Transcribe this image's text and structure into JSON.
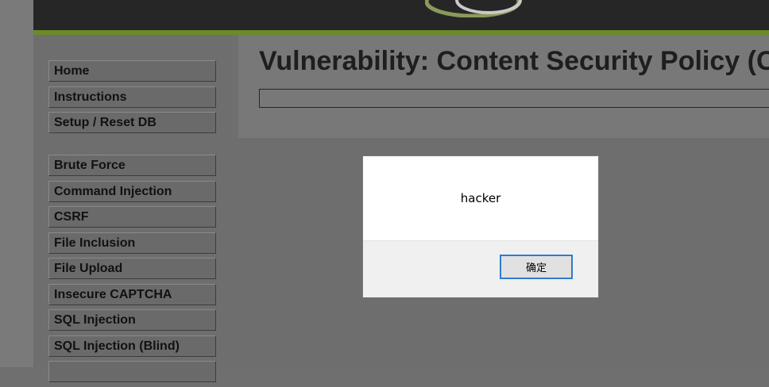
{
  "sidebar": {
    "group1": [
      "Home",
      "Instructions",
      "Setup / Reset DB"
    ],
    "group2": [
      "Brute Force",
      "Command Injection",
      "CSRF",
      "File Inclusion",
      "File Upload",
      "Insecure CAPTCHA",
      "SQL Injection",
      "SQL Injection (Blind)"
    ]
  },
  "main": {
    "title": "Vulnerability: Content Security Policy (CSP) Bypass"
  },
  "dialog": {
    "message": "hacker",
    "ok_label": "确定"
  }
}
